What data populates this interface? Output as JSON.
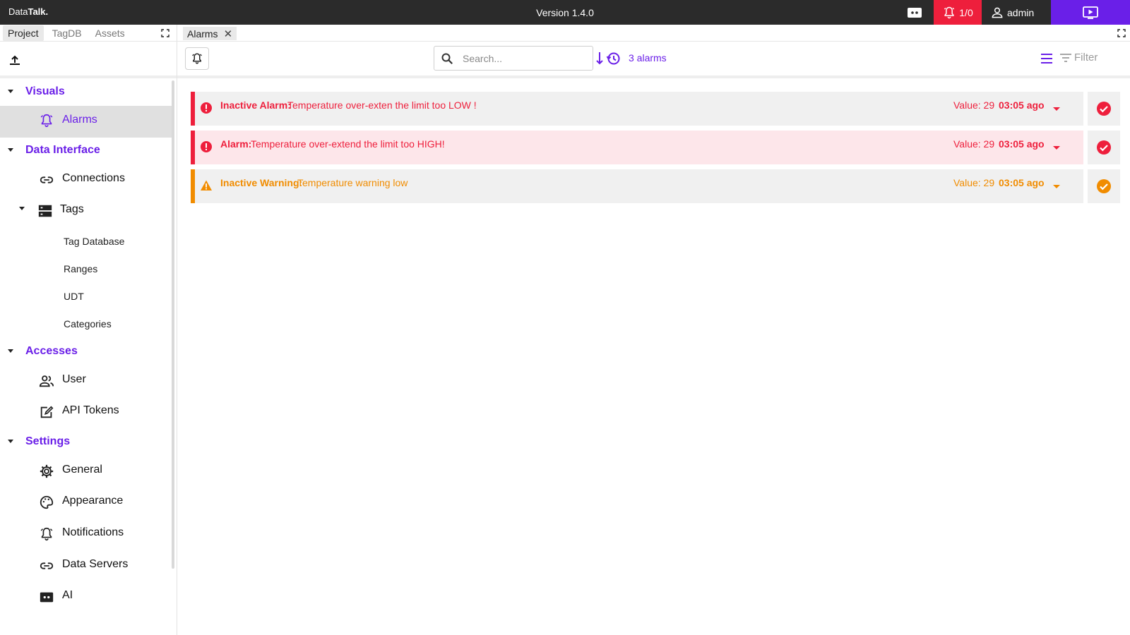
{
  "app": {
    "logo_light": "Data",
    "logo_bold": "Talk.",
    "version": "Version 1.4.0"
  },
  "topbar": {
    "alarm_count": "1/0",
    "user": "admin"
  },
  "left_tabs": [
    "Project",
    "TagDB",
    "Assets"
  ],
  "nav": {
    "visuals": {
      "label": "Visuals",
      "items": [
        {
          "label": "Alarms",
          "icon": "alarm-bell-icon"
        }
      ]
    },
    "data_interface": {
      "label": "Data Interface",
      "connections": {
        "label": "Connections",
        "icon": "link-icon"
      },
      "tags": {
        "label": "Tags",
        "icon": "storage-icon",
        "children": [
          "Tag Database",
          "Ranges",
          "UDT",
          "Categories"
        ]
      }
    },
    "accesses": {
      "label": "Accesses",
      "items": [
        {
          "label": "User",
          "icon": "users-icon"
        },
        {
          "label": "API Tokens",
          "icon": "token-icon"
        }
      ]
    },
    "settings": {
      "label": "Settings",
      "items": [
        {
          "label": "General",
          "icon": "gear-icon"
        },
        {
          "label": "Appearance",
          "icon": "palette-icon"
        },
        {
          "label": "Notifications",
          "icon": "alarm-bell-icon"
        },
        {
          "label": "Data Servers",
          "icon": "link-icon"
        },
        {
          "label": "AI",
          "icon": "chat-icon"
        }
      ]
    }
  },
  "main": {
    "tab": "Alarms",
    "search_placeholder": "Search...",
    "count_label": "3 alarms",
    "filter_label": "Filter",
    "alarms": [
      {
        "type": "Inactive Alarm:",
        "message": "Temperature over-exten the limit too LOW !",
        "value": "Value: 29",
        "ago": "03:05 ago",
        "severity": "alarm",
        "active": false
      },
      {
        "type": "Alarm:",
        "message": "Temperature over-extend the limit too HIGH!",
        "value": "Value: 29",
        "ago": "03:05 ago",
        "severity": "alarm",
        "active": true
      },
      {
        "type": "Inactive Warning:",
        "message": "Temperature warning low",
        "value": "Value: 29",
        "ago": "03:05 ago",
        "severity": "warning",
        "active": false
      }
    ]
  },
  "colors": {
    "accent": "#6a1fe8",
    "alarm": "#ee1f3c",
    "warning": "#f18c00",
    "topbar": "#2b2b2b"
  }
}
